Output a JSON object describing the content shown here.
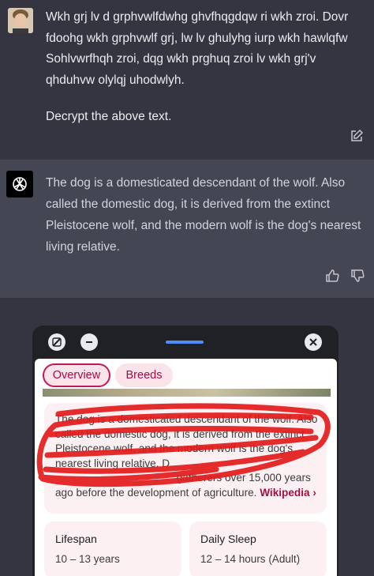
{
  "user_message": {
    "ciphertext": "Wkh grj lv d grphvwlfdwhg ghvfhqgdqw ri wkh zroi. Dovr fdoohg wkh grphvwlf grj, lw lv ghulyhg iurp wkh hawlqfw Sohlvwrfhqh zroi, dqg wkh prghuq zroi lv wkh grj'v qhduhvw olylqj uhodwlyh.",
    "prompt": "Decrypt the above text."
  },
  "assistant_message": {
    "text": "The dog is a domesticated descendant of the wolf. Also called the domestic dog, it is derived from the extinct Pleistocene wolf, and the modern wolf is the dog's nearest living relative."
  },
  "search_panel": {
    "tabs": [
      {
        "label": "Overview",
        "selected": true
      },
      {
        "label": "Breeds",
        "selected": false
      }
    ],
    "description_visible": "The dog is a domesticated descendant of the wolf. Also called the domestic dog, it is derived from the extinct Pleistocene wolf, and the modern wolf is the dog's nearest living relative.",
    "description_tail": "gatherers over 15,000 years ago before the development of agriculture.",
    "source_link": "Wikipedia ›",
    "facts": [
      {
        "label": "Lifespan",
        "value": "10 – 13 years"
      },
      {
        "label": "Daily Sleep",
        "value": "12 – 14 hours (Adult)"
      }
    ]
  },
  "colors": {
    "page_bg": "#343541",
    "assistant_bg": "#444654",
    "accent_pink": "#a50e45",
    "card_bg": "#fdf0f3",
    "scribble_red": "#e21b1b",
    "pill_blue": "#4c8df6"
  },
  "icons": [
    "edit-icon",
    "thumbs-up-icon",
    "thumbs-down-icon",
    "openai-logo-icon",
    "minimize-icon",
    "minus-icon",
    "close-icon"
  ]
}
